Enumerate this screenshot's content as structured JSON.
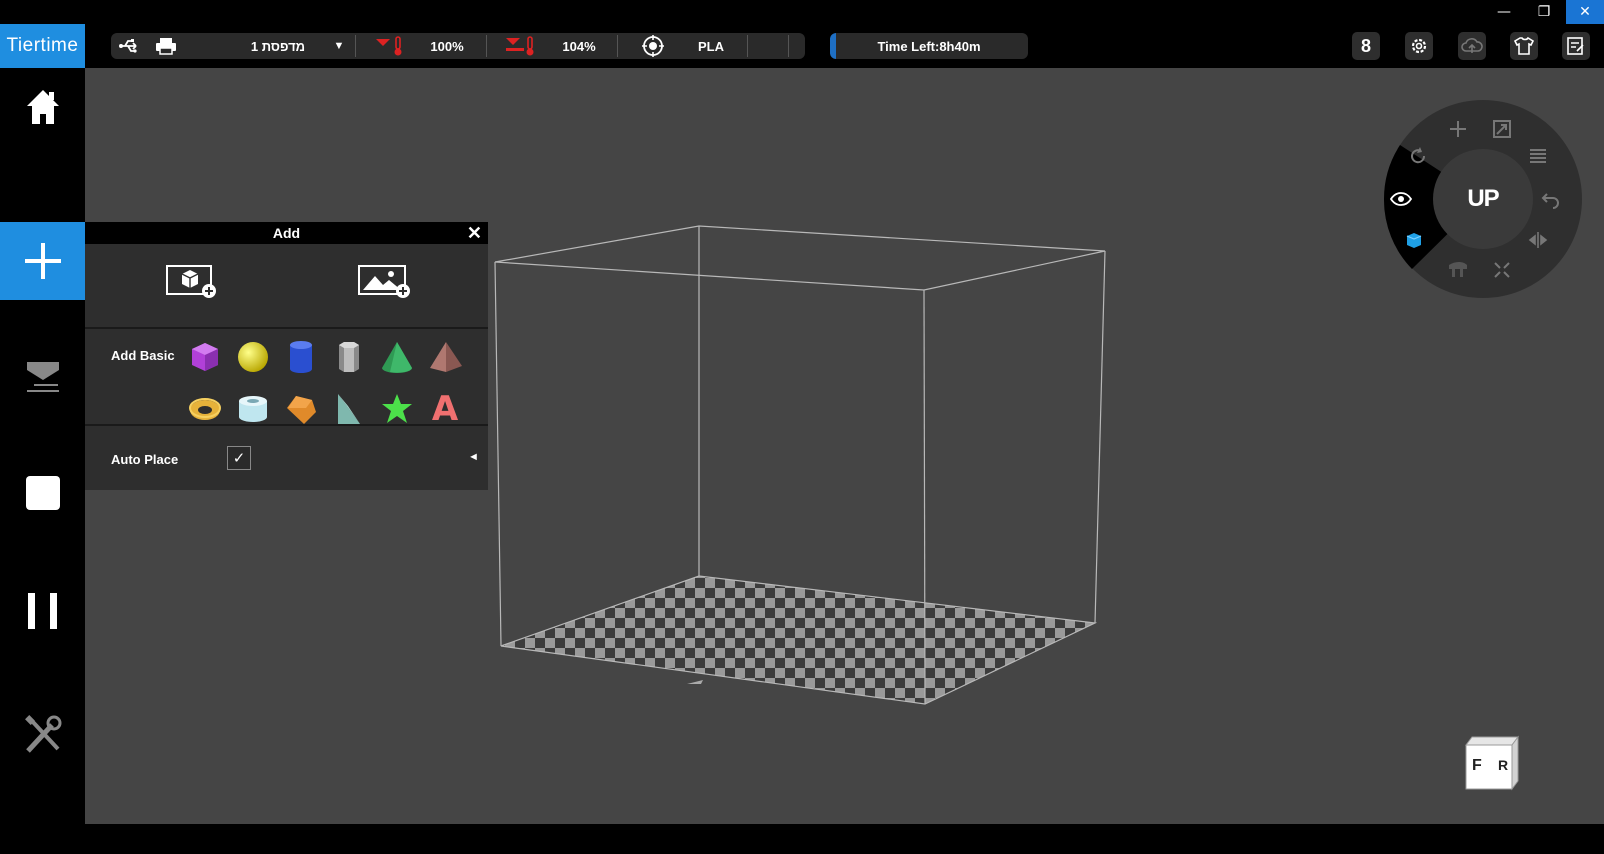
{
  "window": {
    "minimize_glyph": "—",
    "maximize_glyph": "❐",
    "close_glyph": "✕"
  },
  "topbar": {
    "logo": "Tiertime",
    "printer_name": "מדפסת 1",
    "nozzle_temp": "100%",
    "bed_temp": "104%",
    "material": "PLA",
    "time_left": "Time Left:8h40m",
    "time_left_progress": 0.03,
    "accent_color": "#1f8ee0"
  },
  "sidebar": {
    "items": [
      {
        "name": "home-icon"
      },
      {
        "name": "add-icon",
        "active": true
      },
      {
        "name": "print-icon"
      },
      {
        "name": "stop-icon"
      },
      {
        "name": "pause-icon"
      },
      {
        "name": "tools-icon"
      }
    ]
  },
  "add_panel": {
    "title": "Add",
    "close_glyph": "✕",
    "add_basic_label": "Add Basic",
    "auto_place_label": "Auto Place",
    "auto_place_checked": "✓",
    "collapse_glyph": "◄",
    "shapes_row1": [
      "cube",
      "sphere",
      "cylinder",
      "hex-prism",
      "cone",
      "pyramid"
    ],
    "shapes_row2": [
      "torus",
      "tube",
      "pentagon-prism",
      "wedge",
      "star",
      "text-a"
    ],
    "text_shape_letter": "A"
  },
  "dial": {
    "center_label": "UP"
  },
  "viewcube": {
    "front": "F",
    "right": "R"
  }
}
